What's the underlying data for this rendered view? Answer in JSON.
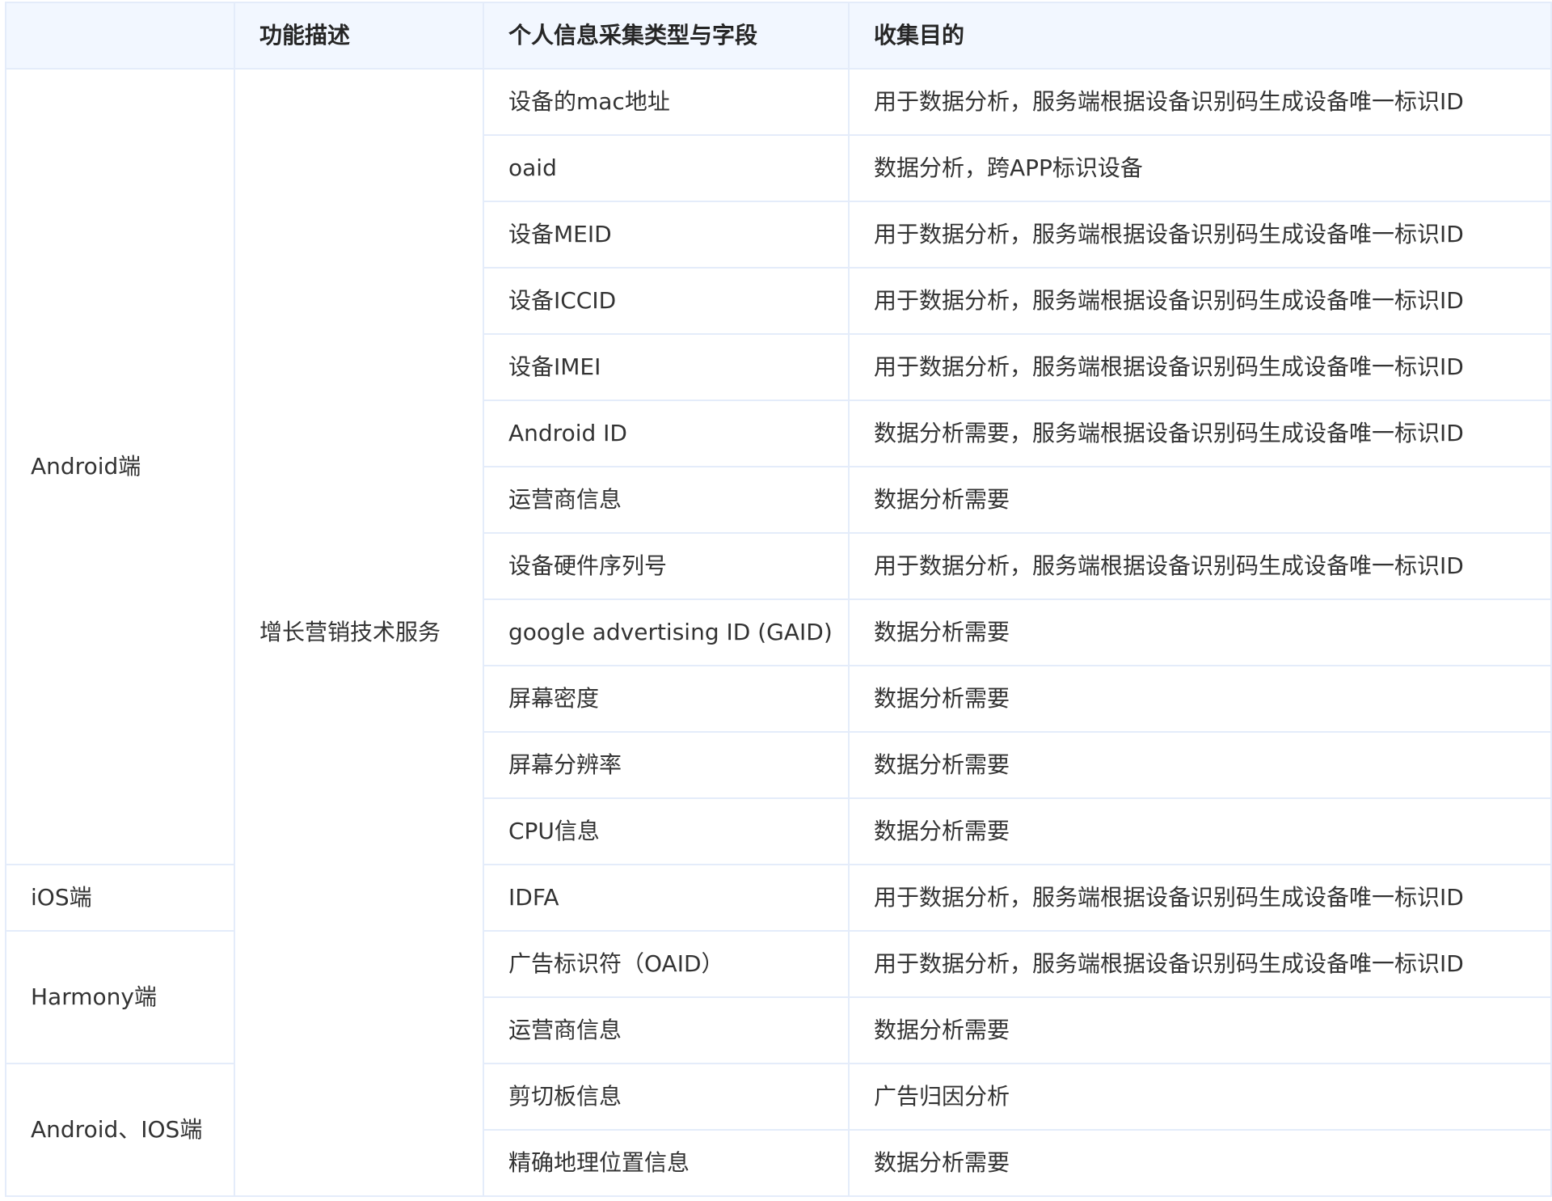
{
  "table": {
    "headers": [
      "",
      "功能描述",
      "个人信息采集类型与字段",
      "收集目的"
    ],
    "function": "增长营销技术服务",
    "groups": [
      {
        "platform": "Android端",
        "rows": [
          {
            "field": "设备的mac地址",
            "purpose": "用于数据分析，服务端根据设备识别码生成设备唯一标识ID"
          },
          {
            "field": "oaid",
            "purpose": "数据分析，跨APP标识设备"
          },
          {
            "field": "设备MEID",
            "purpose": "用于数据分析，服务端根据设备识别码生成设备唯一标识ID"
          },
          {
            "field": "设备ICCID",
            "purpose": "用于数据分析，服务端根据设备识别码生成设备唯一标识ID"
          },
          {
            "field": "设备IMEI",
            "purpose": "用于数据分析，服务端根据设备识别码生成设备唯一标识ID"
          },
          {
            "field": "Android ID",
            "purpose": "数据分析需要，服务端根据设备识别码生成设备唯一标识ID"
          },
          {
            "field": "运营商信息",
            "purpose": "数据分析需要"
          },
          {
            "field": "设备硬件序列号",
            "purpose": "用于数据分析，服务端根据设备识别码生成设备唯一标识ID"
          },
          {
            "field": "google advertising ID (GAID)",
            "purpose": "数据分析需要"
          },
          {
            "field": "屏幕密度",
            "purpose": "数据分析需要"
          },
          {
            "field": "屏幕分辨率",
            "purpose": "数据分析需要"
          },
          {
            "field": "CPU信息",
            "purpose": "数据分析需要"
          }
        ]
      },
      {
        "platform": "iOS端",
        "rows": [
          {
            "field": "IDFA",
            "purpose": "用于数据分析，服务端根据设备识别码生成设备唯一标识ID"
          }
        ]
      },
      {
        "platform": "Harmony端",
        "rows": [
          {
            "field": "广告标识符（OAID）",
            "purpose": "用于数据分析，服务端根据设备识别码生成设备唯一标识ID"
          },
          {
            "field": "运营商信息",
            "purpose": "数据分析需要"
          }
        ]
      },
      {
        "platform": "Android、IOS端",
        "rows": [
          {
            "field": "剪切板信息",
            "purpose": "广告归因分析"
          },
          {
            "field": "精确地理位置信息",
            "purpose": "数据分析需要"
          }
        ]
      }
    ]
  }
}
